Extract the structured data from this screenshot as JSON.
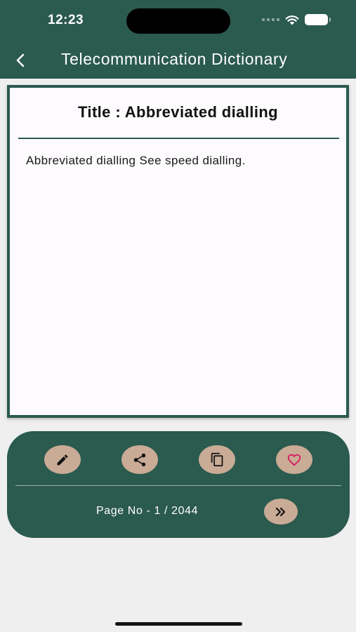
{
  "status_bar": {
    "time": "12:23"
  },
  "header": {
    "title": "Telecommunication Dictionary"
  },
  "entry": {
    "title": "Title : Abbreviated dialling",
    "definition": "Abbreviated dialling See speed dialling."
  },
  "actions": [
    {
      "name": "edit",
      "icon": "pencil-icon"
    },
    {
      "name": "share",
      "icon": "share-icon"
    },
    {
      "name": "copy",
      "icon": "copy-icon"
    },
    {
      "name": "favorite",
      "icon": "heart-icon"
    }
  ],
  "pagination": {
    "label": "Page No - 1 / 2044",
    "current": 1,
    "total": 2044,
    "next_icon": "double-chevron-right-icon"
  },
  "colors": {
    "primary": "#2b5a4e",
    "button_bg": "#c9ab96",
    "heart": "#d81b60",
    "background": "#efefef"
  }
}
